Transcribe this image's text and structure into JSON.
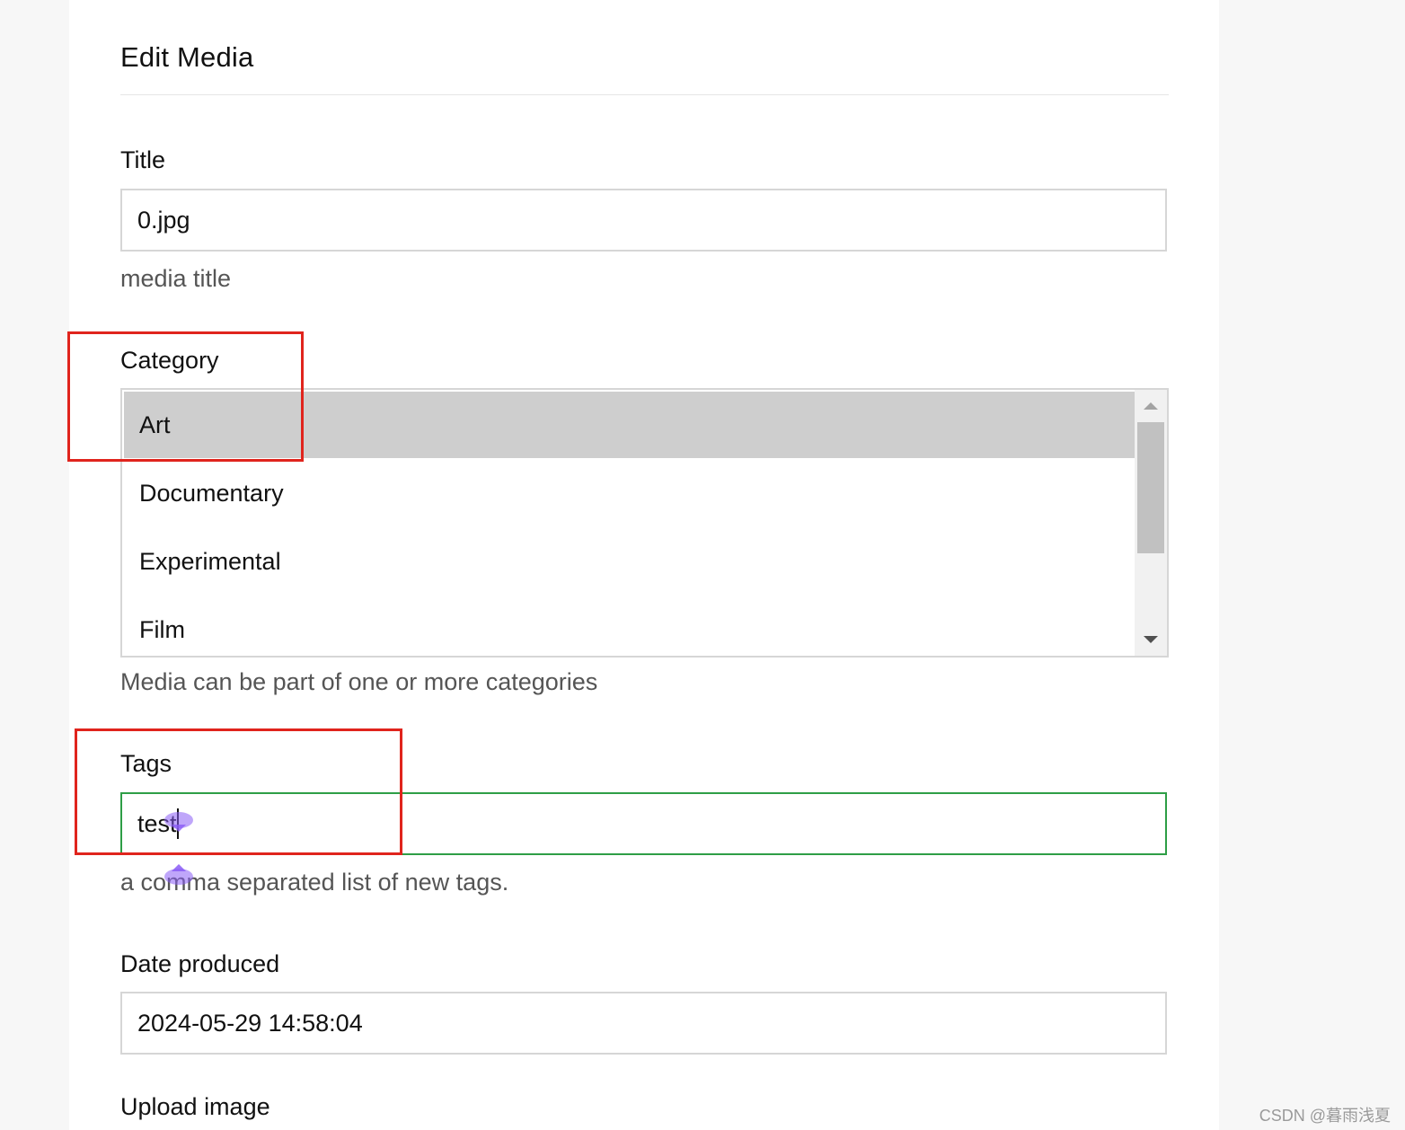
{
  "form": {
    "heading": "Edit Media",
    "title_field": {
      "label": "Title",
      "value": "0.jpg",
      "help": "media title"
    },
    "category_field": {
      "label": "Category",
      "options": [
        "Art",
        "Documentary",
        "Experimental",
        "Film"
      ],
      "selected": "Art",
      "help": "Media can be part of one or more categories"
    },
    "tags_field": {
      "label": "Tags",
      "value": "test",
      "help": "a comma separated list of new tags."
    },
    "date_field": {
      "label": "Date produced",
      "value": "2024-05-29 14:58:04"
    },
    "upload_field": {
      "label": "Upload image"
    }
  },
  "annotations": {
    "color": "#e0241d"
  },
  "colors": {
    "focus_border": "#2e9e46",
    "selected_option_bg": "#cecece",
    "ime_marker": "#8b5cf6"
  },
  "watermark": "CSDN @暮雨浅夏"
}
